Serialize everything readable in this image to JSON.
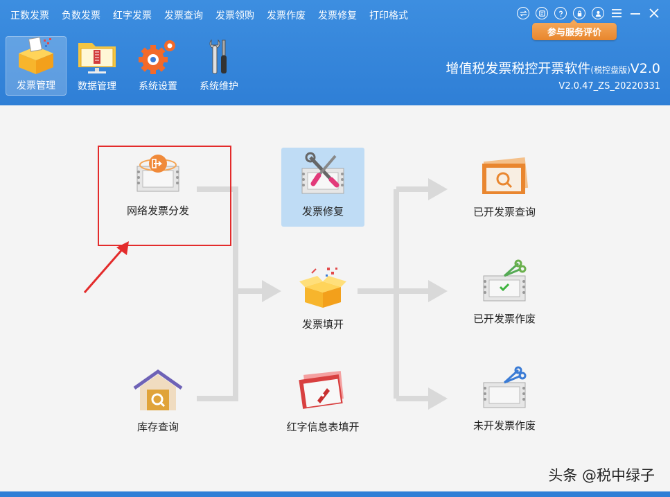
{
  "menu": [
    "正数发票",
    "负数发票",
    "红字发票",
    "发票查询",
    "发票领购",
    "发票作废",
    "发票修复",
    "打印格式"
  ],
  "eval_button": "参与服务评价",
  "toolbar": [
    {
      "label": "发票管理",
      "icon": "invoice-box-icon",
      "active": true
    },
    {
      "label": "数据管理",
      "icon": "folder-monitor-icon",
      "active": false
    },
    {
      "label": "系统设置",
      "icon": "gears-icon",
      "active": false
    },
    {
      "label": "系统维护",
      "icon": "tools-icon",
      "active": false
    }
  ],
  "app": {
    "title": "增值税发票税控开票软件",
    "title_suffix": "(税控盘版)",
    "title_version": "V2.0",
    "version": "V2.0.47_ZS_20220331"
  },
  "nodes": {
    "network_dist": "网络发票分发",
    "repair": "发票修复",
    "fill": "发票填开",
    "inventory": "库存查询",
    "red_info": "红字信息表填开",
    "issued_query": "已开发票查询",
    "issued_void": "已开发票作废",
    "unissued_void": "未开发票作废"
  },
  "watermark": "头条 @税中绿子",
  "colors": {
    "brand_blue": "#2f7fd6",
    "accent_orange": "#e8862d",
    "highlight_red": "#e32b2b"
  }
}
